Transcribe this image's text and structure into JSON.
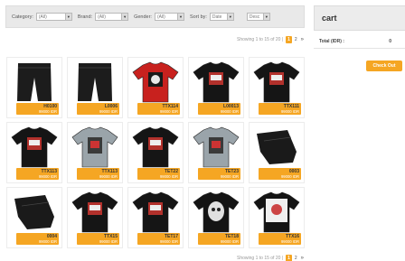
{
  "filters": {
    "category": {
      "label": "Category:",
      "value": "(All)"
    },
    "brand": {
      "label": "Brand:",
      "value": "(All)"
    },
    "gender": {
      "label": "Gender:",
      "value": "(All)"
    },
    "sort": {
      "label": "Sort by:",
      "value": "Date",
      "order": "Desc"
    }
  },
  "pagination": {
    "showing": "Showing 1 to 15 of 20 |",
    "pages": [
      "1",
      "2"
    ],
    "current": "1",
    "next": "»"
  },
  "products": [
    {
      "code": "H0100",
      "price": "99000 IDR",
      "icon": "black-jeans"
    },
    {
      "code": "L0006",
      "price": "99000 IDR",
      "icon": "black-jeans"
    },
    {
      "code": "TTX114",
      "price": "99000 IDR",
      "icon": "red-tshirt"
    },
    {
      "code": "L00013",
      "price": "99000 IDR",
      "icon": "black-tshirt-print"
    },
    {
      "code": "TTX111",
      "price": "99000 IDR",
      "icon": "black-tshirt-print"
    },
    {
      "code": "TTX113",
      "price": "99000 IDR",
      "icon": "black-tshirt-print"
    },
    {
      "code": "TTX113",
      "price": "99000 IDR",
      "icon": "grey-tshirt-print"
    },
    {
      "code": "TET22",
      "price": "99000 IDR",
      "icon": "black-tshirt-print"
    },
    {
      "code": "TET23",
      "price": "99000 IDR",
      "icon": "grey-tshirt-print"
    },
    {
      "code": "0003",
      "price": "99000 IDR",
      "icon": "black-jeans-folded"
    },
    {
      "code": "0004",
      "price": "99000 IDR",
      "icon": "black-jeans-folded"
    },
    {
      "code": "TTX15",
      "price": "99000 IDR",
      "icon": "black-tshirt-print"
    },
    {
      "code": "TET17",
      "price": "99000 IDR",
      "icon": "black-tshirt-print"
    },
    {
      "code": "TET18",
      "price": "99000 IDR",
      "icon": "black-tshirt-skull"
    },
    {
      "code": "TTX16",
      "price": "99000 IDR",
      "icon": "black-tshirt-white-print"
    }
  ],
  "cart": {
    "title": "cart",
    "total_label": "Total (IDR) :",
    "total_value": "0",
    "checkout_label": "Check Out"
  },
  "colors": {
    "accent": "#f5a623",
    "panel": "#ececec"
  }
}
